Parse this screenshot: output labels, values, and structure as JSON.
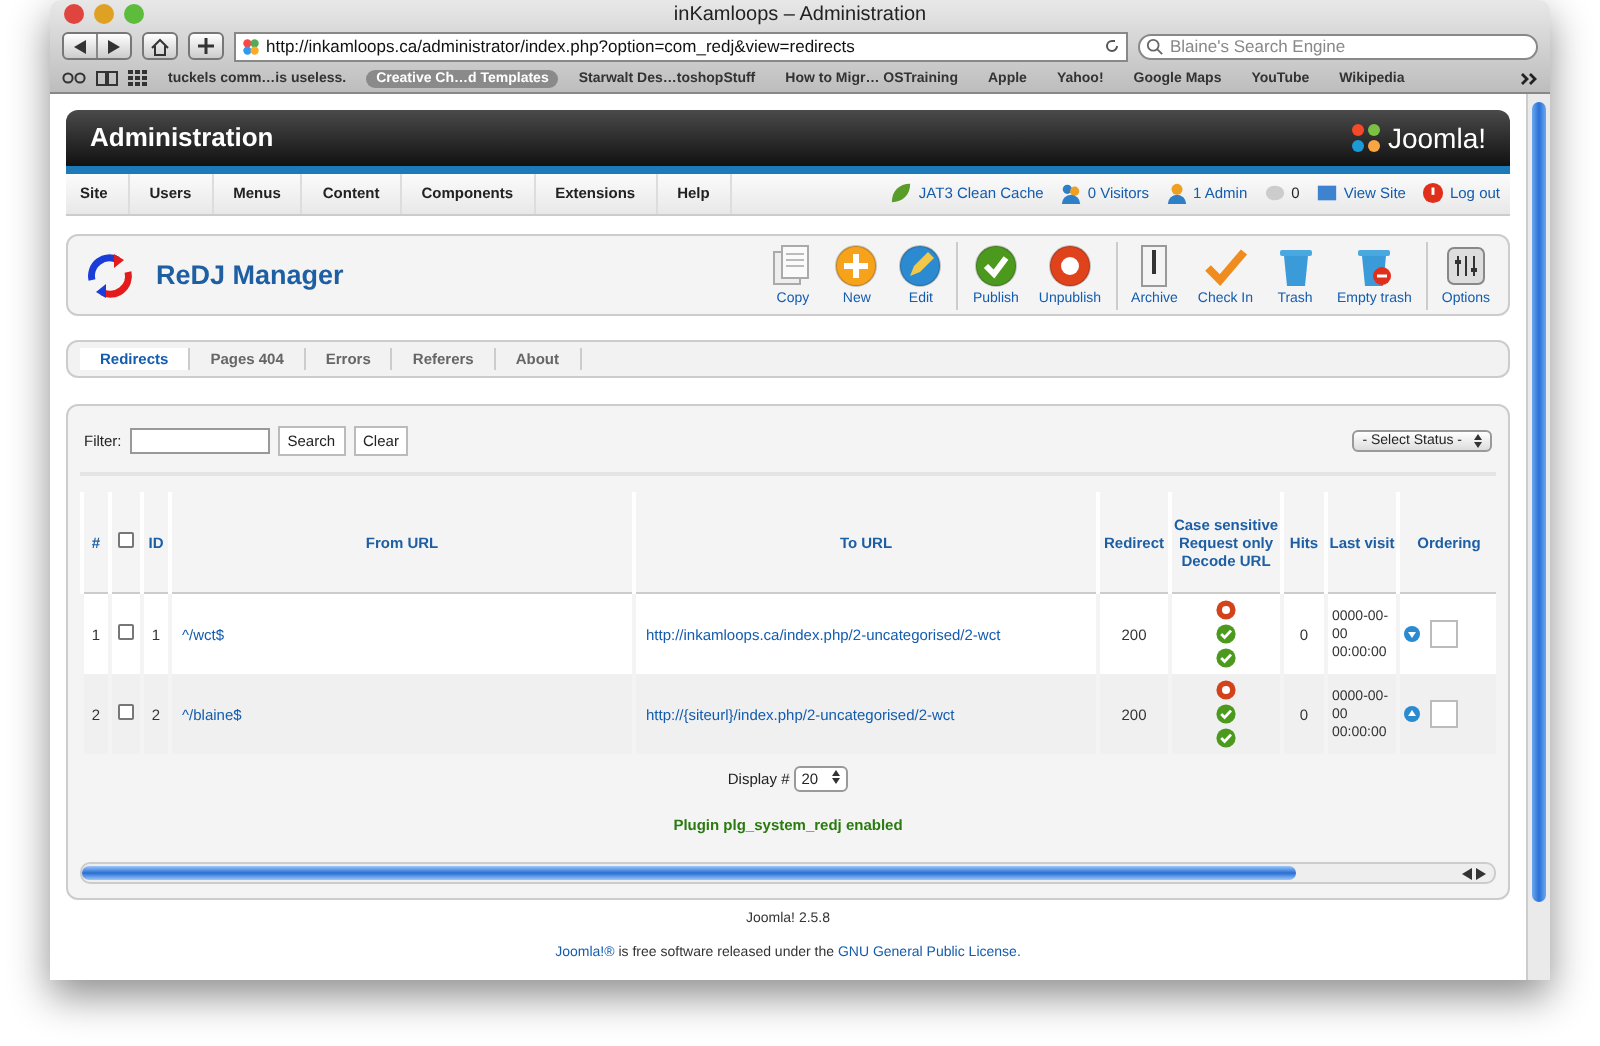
{
  "window": {
    "title": "inKamloops – Administration"
  },
  "browser": {
    "url": "http://inkamloops.ca/administrator/index.php?option=com_redj&view=redirects",
    "search_placeholder": "Blaine's Search Engine",
    "bookmarks": [
      {
        "label": "tuckels comm…is useless.",
        "selected": false
      },
      {
        "label": "Creative Ch…d Templates",
        "selected": true
      },
      {
        "label": "Starwalt Des…toshopStuff",
        "selected": false
      },
      {
        "label": "How to Migr… OSTraining",
        "selected": false
      },
      {
        "label": "Apple",
        "selected": false
      },
      {
        "label": "Yahoo!",
        "selected": false
      },
      {
        "label": "Google Maps",
        "selected": false
      },
      {
        "label": "YouTube",
        "selected": false
      },
      {
        "label": "Wikipedia",
        "selected": false
      }
    ]
  },
  "header": {
    "title": "Administration",
    "logo": "Joomla!"
  },
  "menu": [
    "Site",
    "Users",
    "Menus",
    "Content",
    "Components",
    "Extensions",
    "Help"
  ],
  "status_items": [
    {
      "kind": "cache",
      "label": "JAT3 Clean Cache"
    },
    {
      "kind": "visitors",
      "label": "0 Visitors"
    },
    {
      "kind": "admins",
      "label": "1 Admin"
    },
    {
      "kind": "messages",
      "label": "0"
    },
    {
      "kind": "view",
      "label": "View Site"
    },
    {
      "kind": "logout",
      "label": "Log out"
    }
  ],
  "component": {
    "title": "ReDJ Manager"
  },
  "toolbar": [
    {
      "kind": "copy",
      "label": "Copy",
      "separator_before": false
    },
    {
      "kind": "new",
      "label": "New",
      "separator_before": false
    },
    {
      "kind": "edit",
      "label": "Edit",
      "separator_before": false
    },
    {
      "kind": "publish",
      "label": "Publish",
      "separator_before": true
    },
    {
      "kind": "unpublish",
      "label": "Unpublish",
      "separator_before": false
    },
    {
      "kind": "archive",
      "label": "Archive",
      "separator_before": true
    },
    {
      "kind": "checkin",
      "label": "Check In",
      "separator_before": false
    },
    {
      "kind": "trash",
      "label": "Trash",
      "separator_before": false
    },
    {
      "kind": "emptytrash",
      "label": "Empty trash",
      "separator_before": false
    },
    {
      "kind": "options",
      "label": "Options",
      "separator_before": true
    }
  ],
  "tabs": [
    {
      "label": "Redirects",
      "selected": true
    },
    {
      "label": "Pages 404",
      "selected": false
    },
    {
      "label": "Errors",
      "selected": false
    },
    {
      "label": "Referers",
      "selected": false
    },
    {
      "label": "About",
      "selected": false
    }
  ],
  "filter": {
    "label": "Filter:",
    "search_button": "Search",
    "clear_button": "Clear",
    "status_select": "- Select Status -"
  },
  "table": {
    "header_checkbox": {
      "checked": false
    },
    "columns": [
      "#",
      "ID",
      "From URL",
      "To URL",
      "Redirect",
      "Case sensitive\nRequest only\nDecode URL",
      "Hits",
      "Last visit",
      "Ordering"
    ],
    "rows": [
      {
        "num": "1",
        "checked": false,
        "id": "1",
        "from_url": "^/wct$",
        "to_url": "http://inkamloops.ca/index.php/2-uncategorised/2-wct",
        "redirect": "200",
        "case_sensitive": false,
        "request_only": true,
        "decode_url": true,
        "hits": "0",
        "last_visit": "0000-00-00 00:00:00",
        "ordering": {
          "kind": "down"
        }
      },
      {
        "num": "2",
        "checked": false,
        "id": "2",
        "from_url": "^/blaine$",
        "to_url": "http://{siteurl}/index.php/2-uncategorised/2-wct",
        "redirect": "200",
        "case_sensitive": false,
        "request_only": true,
        "decode_url": true,
        "hits": "0",
        "last_visit": "0000-00-00 00:00:00",
        "ordering": {
          "kind": "up"
        }
      }
    ]
  },
  "pagination": {
    "label": "Display #",
    "value": "20"
  },
  "plugin_message": "Plugin plg_system_redj enabled",
  "footer": {
    "version": "Joomla! 2.5.8",
    "license_link_1": "Joomla!®",
    "license_text": " is free software released under the ",
    "license_link_2": "GNU General Public License."
  }
}
